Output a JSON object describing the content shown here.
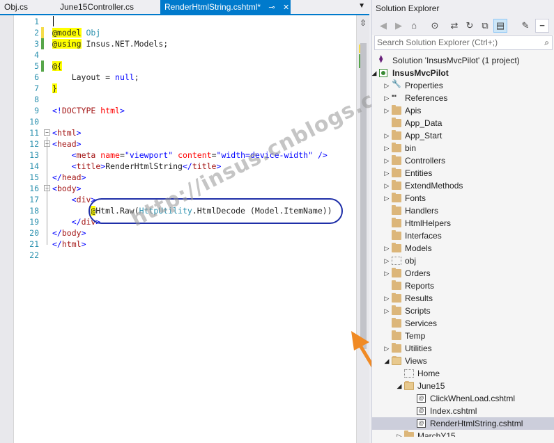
{
  "tabs": [
    {
      "label": "Obj.cs",
      "active": false
    },
    {
      "label": "June15Controller.cs",
      "active": false
    },
    {
      "label": "RenderHtmlString.cshtml*",
      "active": true
    }
  ],
  "tab_pin_icon": "pin-icon",
  "tab_close_icon": "close-icon",
  "editor": {
    "line_numbers": [
      "1",
      "2",
      "3",
      "4",
      "5",
      "6",
      "7",
      "8",
      "9",
      "10",
      "11",
      "12",
      "13",
      "14",
      "15",
      "16",
      "17",
      "18",
      "19",
      "20",
      "21",
      "22"
    ],
    "lines": [
      "",
      "@model Obj",
      "@using Insus.NET.Models;",
      "",
      "@{",
      "    Layout = null;",
      "}",
      "",
      "<!DOCTYPE html>",
      "",
      "<html>",
      "<head>",
      "    <meta name=\"viewport\" content=\"width=device-width\" />",
      "    <title>RenderHtmlString</title>",
      "</head>",
      "<body>",
      "    <div>",
      "        @Html.Raw(HttpUtility.HtmlDecode (Model.ItemName))",
      "    </div>",
      "</body>",
      "</html>",
      ""
    ]
  },
  "watermark": "http://insus.cnblogs.com",
  "solution_explorer": {
    "title": "Solution Explorer",
    "search_placeholder": "Search Solution Explorer (Ctrl+;)",
    "toolbar_icons": [
      "back-icon",
      "forward-icon",
      "home-icon",
      "history-icon",
      "sync-icon",
      "refresh-icon",
      "collapse-all-icon",
      "show-all-files-icon",
      "properties-icon",
      "preview-icon"
    ],
    "tree": [
      {
        "label": "Solution 'InsusMvcPilot' (1 project)",
        "icon": "solution-icon",
        "level": 0,
        "expander": "",
        "bold": false
      },
      {
        "label": "InsusMvcPilot",
        "icon": "project-icon",
        "level": 0,
        "expander": "expanded",
        "bold": true
      },
      {
        "label": "Properties",
        "icon": "wrench-icon",
        "level": 1,
        "expander": "collapsed"
      },
      {
        "label": "References",
        "icon": "references-icon",
        "level": 1,
        "expander": "collapsed"
      },
      {
        "label": "Apis",
        "icon": "folder-icon",
        "level": 1,
        "expander": "collapsed"
      },
      {
        "label": "App_Data",
        "icon": "folder-icon",
        "level": 1,
        "expander": ""
      },
      {
        "label": "App_Start",
        "icon": "folder-icon",
        "level": 1,
        "expander": "collapsed"
      },
      {
        "label": "bin",
        "icon": "folder-icon",
        "level": 1,
        "expander": "collapsed"
      },
      {
        "label": "Controllers",
        "icon": "folder-icon",
        "level": 1,
        "expander": "collapsed"
      },
      {
        "label": "Entities",
        "icon": "folder-icon",
        "level": 1,
        "expander": "collapsed"
      },
      {
        "label": "ExtendMethods",
        "icon": "folder-icon",
        "level": 1,
        "expander": "collapsed"
      },
      {
        "label": "Fonts",
        "icon": "folder-icon",
        "level": 1,
        "expander": "collapsed"
      },
      {
        "label": "Handlers",
        "icon": "folder-icon",
        "level": 1,
        "expander": ""
      },
      {
        "label": "HtmlHelpers",
        "icon": "folder-icon",
        "level": 1,
        "expander": ""
      },
      {
        "label": "Interfaces",
        "icon": "folder-icon",
        "level": 1,
        "expander": ""
      },
      {
        "label": "Models",
        "icon": "folder-icon",
        "level": 1,
        "expander": "collapsed"
      },
      {
        "label": "obj",
        "icon": "hidden-folder-icon",
        "level": 1,
        "expander": "collapsed"
      },
      {
        "label": "Orders",
        "icon": "folder-icon",
        "level": 1,
        "expander": "collapsed"
      },
      {
        "label": "Reports",
        "icon": "folder-icon",
        "level": 1,
        "expander": ""
      },
      {
        "label": "Results",
        "icon": "folder-icon",
        "level": 1,
        "expander": "collapsed"
      },
      {
        "label": "Scripts",
        "icon": "folder-icon",
        "level": 1,
        "expander": "collapsed"
      },
      {
        "label": "Services",
        "icon": "folder-icon",
        "level": 1,
        "expander": ""
      },
      {
        "label": "Temp",
        "icon": "folder-icon",
        "level": 1,
        "expander": ""
      },
      {
        "label": "Utilities",
        "icon": "folder-icon",
        "level": 1,
        "expander": "collapsed"
      },
      {
        "label": "Views",
        "icon": "open-folder-icon",
        "level": 1,
        "expander": "expanded"
      },
      {
        "label": "Home",
        "icon": "hidden-folder-icon",
        "level": 2,
        "expander": ""
      },
      {
        "label": "June15",
        "icon": "open-folder-icon",
        "level": 2,
        "expander": "expanded"
      },
      {
        "label": "ClickWhenLoad.cshtml",
        "icon": "cshtml-file-icon",
        "level": 3,
        "expander": ""
      },
      {
        "label": "Index.cshtml",
        "icon": "cshtml-file-icon",
        "level": 3,
        "expander": ""
      },
      {
        "label": "RenderHtmlString.cshtml",
        "icon": "cshtml-file-icon",
        "level": 3,
        "expander": "",
        "selected": true
      },
      {
        "label": "MarchY15",
        "icon": "folder-icon",
        "level": 2,
        "expander": "collapsed"
      }
    ]
  }
}
